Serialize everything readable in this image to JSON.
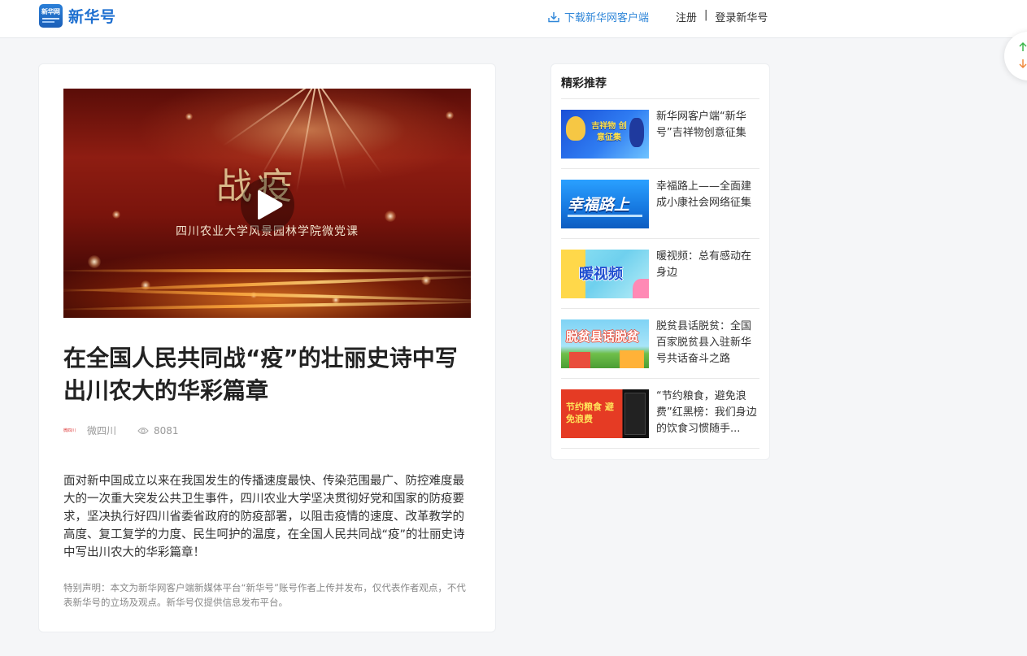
{
  "header": {
    "logo_text": "新华号",
    "logo_icon_text": "新华网",
    "download_label": "下载新华网客户端",
    "register_label": "注册",
    "separator": "|",
    "login_label": "登录新华号"
  },
  "article": {
    "video": {
      "title": "战疫",
      "subtitle": "四川农业大学风景园林学院微党课"
    },
    "title": "在全国人民共同战“疫”的壮丽史诗中写出川农大的华彩篇章",
    "author": "微四川",
    "author_avatar_text": "微四川",
    "views": "8081",
    "summary": "面对新中国成立以来在我国发生的传播速度最快、传染范围最广、防控难度最大的一次重大突发公共卫生事件，四川农业大学坚决贯彻好党和国家的防疫要求，坚决执行好四川省委省政府的防疫部署，以阻击疫情的速度、改革教学的高度、复工复学的力度、民生呵护的温度，在全国人民共同战“疫”的壮丽史诗中写出川农大的华彩篇章！",
    "notice": "特别声明：本文为新华网客户端新媒体平台“新华号”账号作者上传并发布，仅代表作者观点，不代表新华号的立场及观点。新华号仅提供信息发布平台。"
  },
  "sidebar": {
    "title": "精彩推荐",
    "items": [
      {
        "text": "新华网客户端“新华号”吉祥物创意征集",
        "thumb_label": "吉祥物 创意征集"
      },
      {
        "text": "幸福路上——全面建成小康社会网络征集",
        "thumb_label": "幸福路上"
      },
      {
        "text": "暖视频：总有感动在身边",
        "thumb_label": "暖视频"
      },
      {
        "text": "脱贫县话脱贫：全国百家脱贫县入驻新华号共话奋斗之路",
        "thumb_label": "脱贫县话脱贫"
      },
      {
        "text": "“节约粮食，避免浪费”红黑榜：我们身边的饮食习惯随手...",
        "thumb_label": "节约粮食 避免浪费"
      }
    ]
  },
  "colors": {
    "brand_blue": "#1d6fd0",
    "link_blue": "#2f86d8",
    "scroll_up": "#3bb54a",
    "scroll_down": "#f08a3c"
  }
}
